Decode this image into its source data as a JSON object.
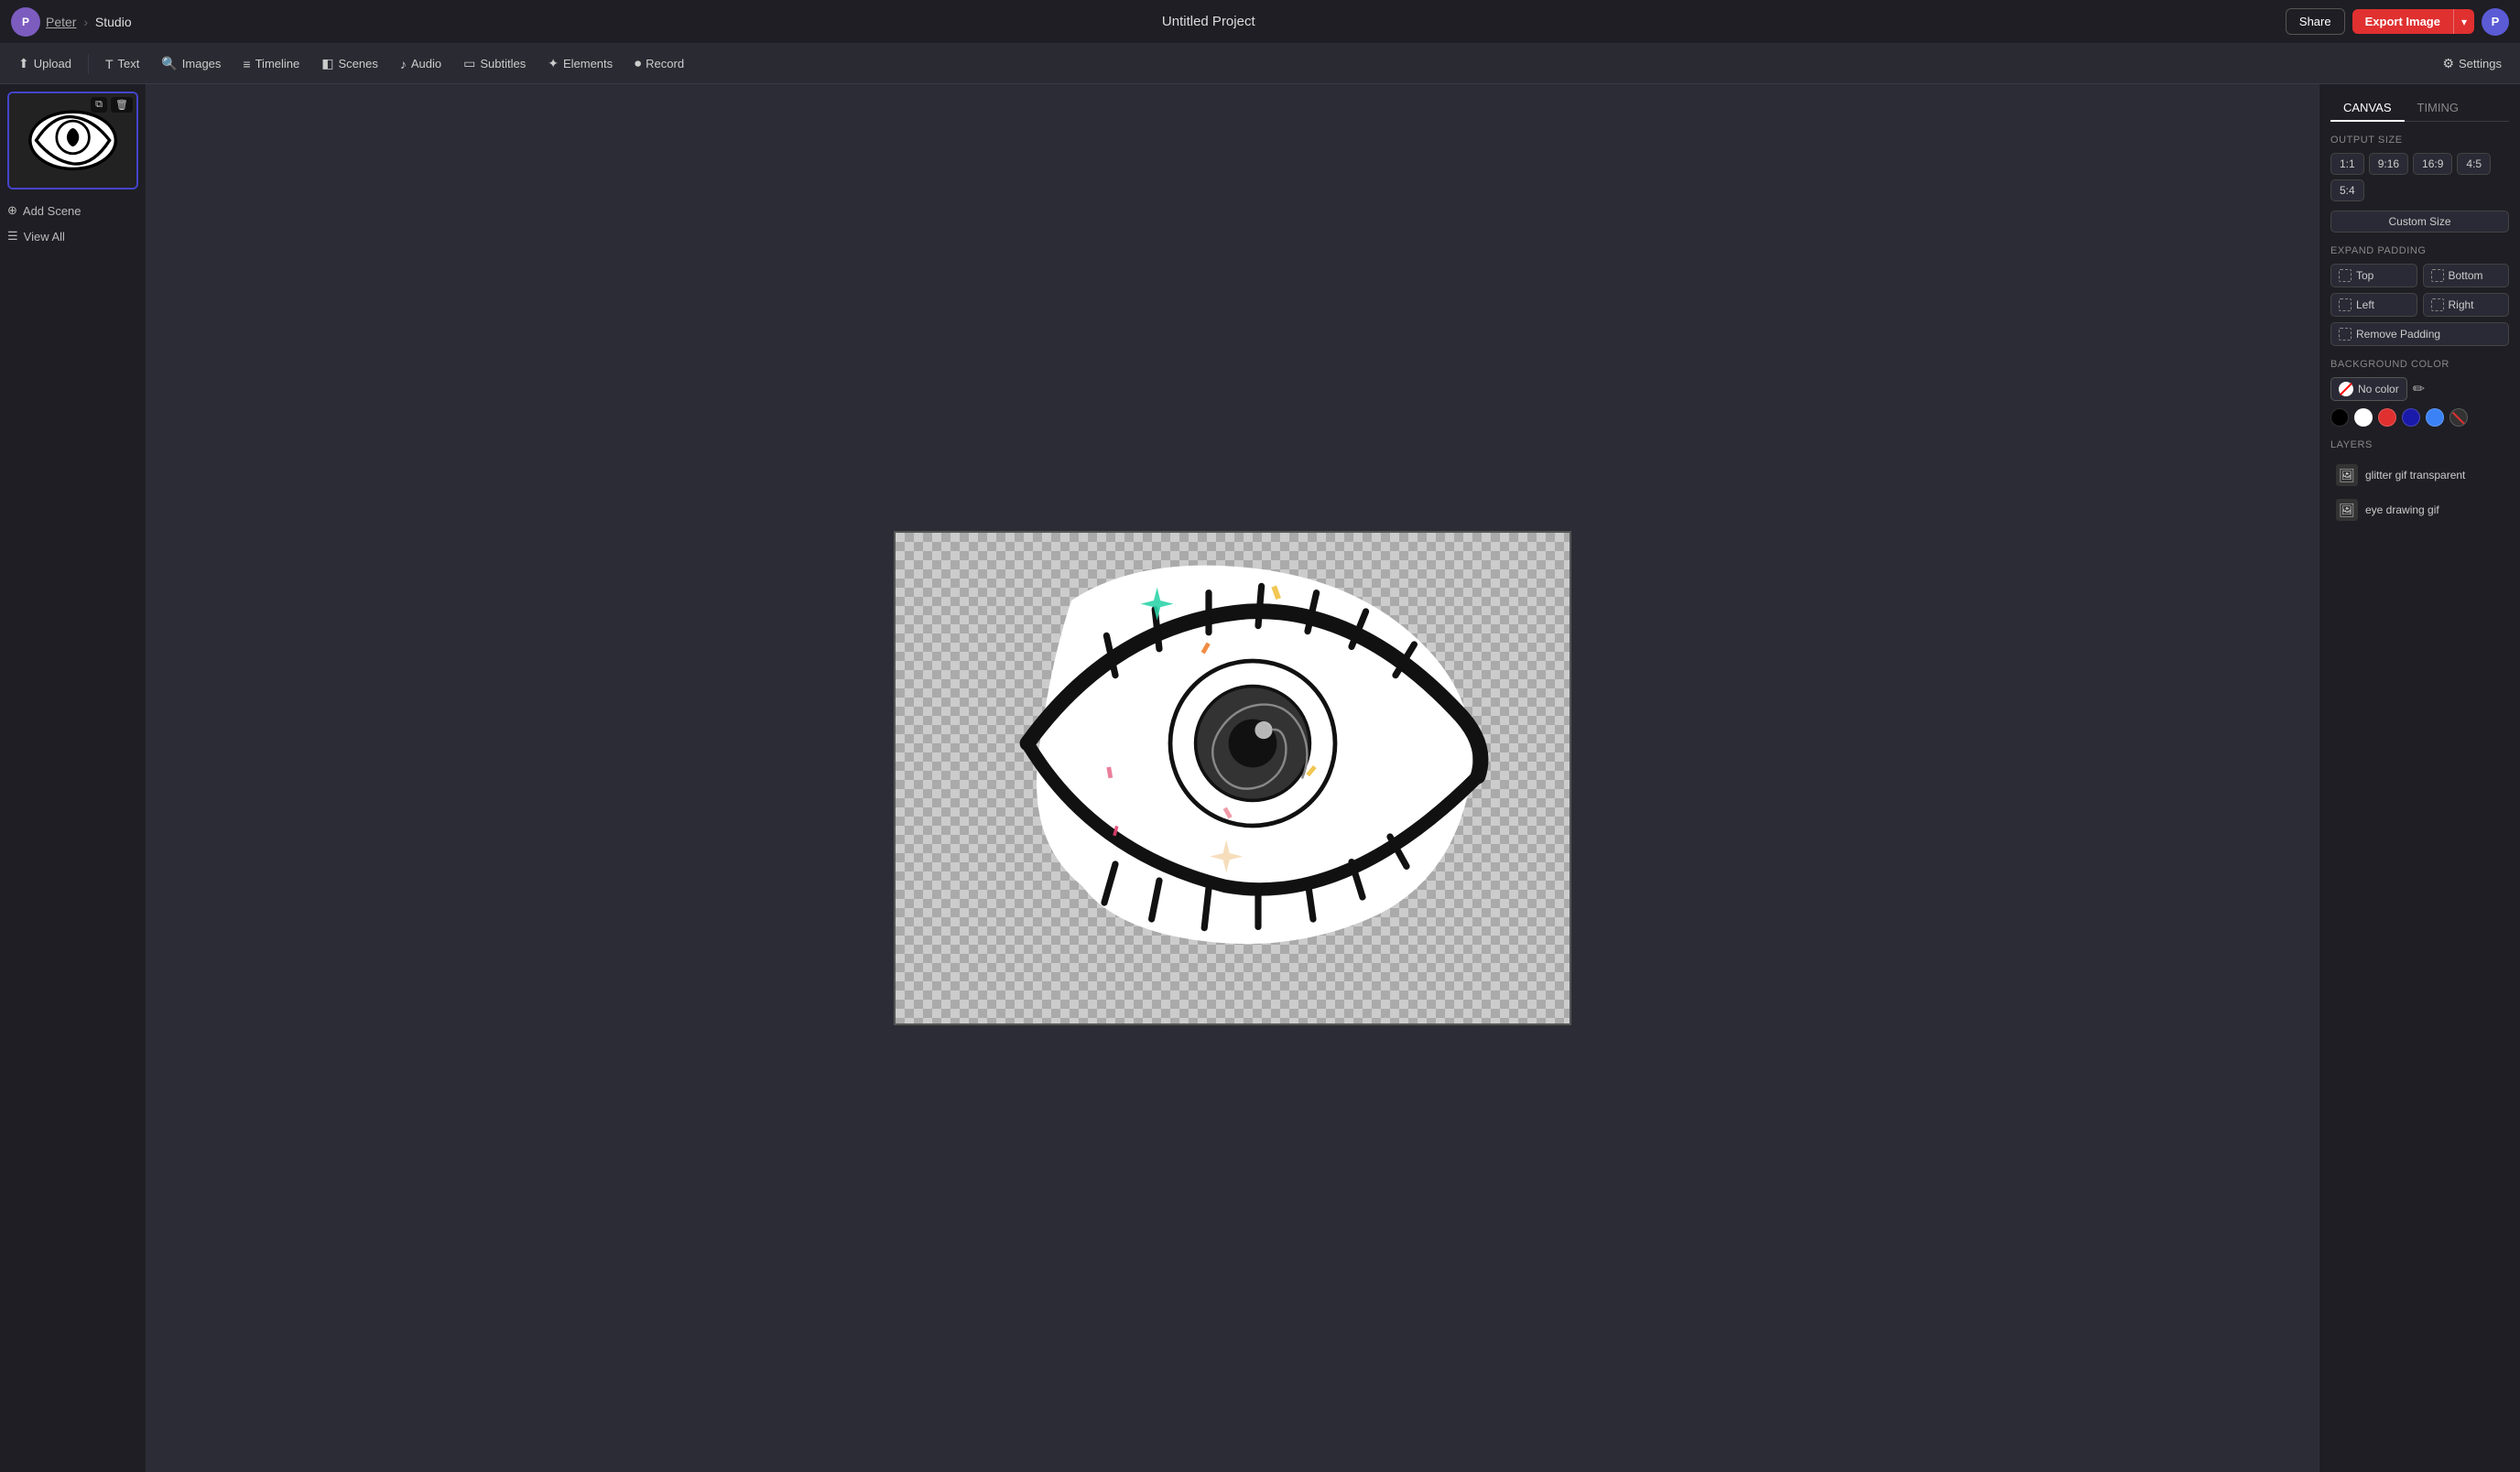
{
  "topbar": {
    "user_name": "Peter",
    "breadcrumb_sep": "›",
    "app_name": "Studio",
    "project_title": "Untitled Project",
    "share_label": "Share",
    "export_label": "Export Image",
    "user_initial": "P"
  },
  "toolbar": {
    "upload_label": "Upload",
    "text_label": "Text",
    "images_label": "Images",
    "timeline_label": "Timeline",
    "scenes_label": "Scenes",
    "audio_label": "Audio",
    "subtitles_label": "Subtitles",
    "elements_label": "Elements",
    "record_label": "Record",
    "settings_label": "Settings"
  },
  "left_panel": {
    "add_scene_label": "Add Scene",
    "view_all_label": "View All"
  },
  "right_panel": {
    "canvas_tab": "CANVAS",
    "timing_tab": "TIMING",
    "output_size_title": "OUTPUT SIZE",
    "sizes": [
      "1:1",
      "9:16",
      "16:9",
      "4:5",
      "5:4"
    ],
    "custom_size_label": "Custom Size",
    "expand_padding_title": "EXPAND PADDING",
    "top_label": "Top",
    "bottom_label": "Bottom",
    "left_label": "Left",
    "right_label": "Right",
    "remove_padding_label": "Remove Padding",
    "background_color_title": "BACKGROUND COLOR",
    "no_color_label": "No color",
    "layers_title": "LAYERS",
    "layers": [
      {
        "name": "glitter gif transparent",
        "icon": "🖼"
      },
      {
        "name": "eye drawing gif",
        "icon": "🖼"
      }
    ]
  }
}
